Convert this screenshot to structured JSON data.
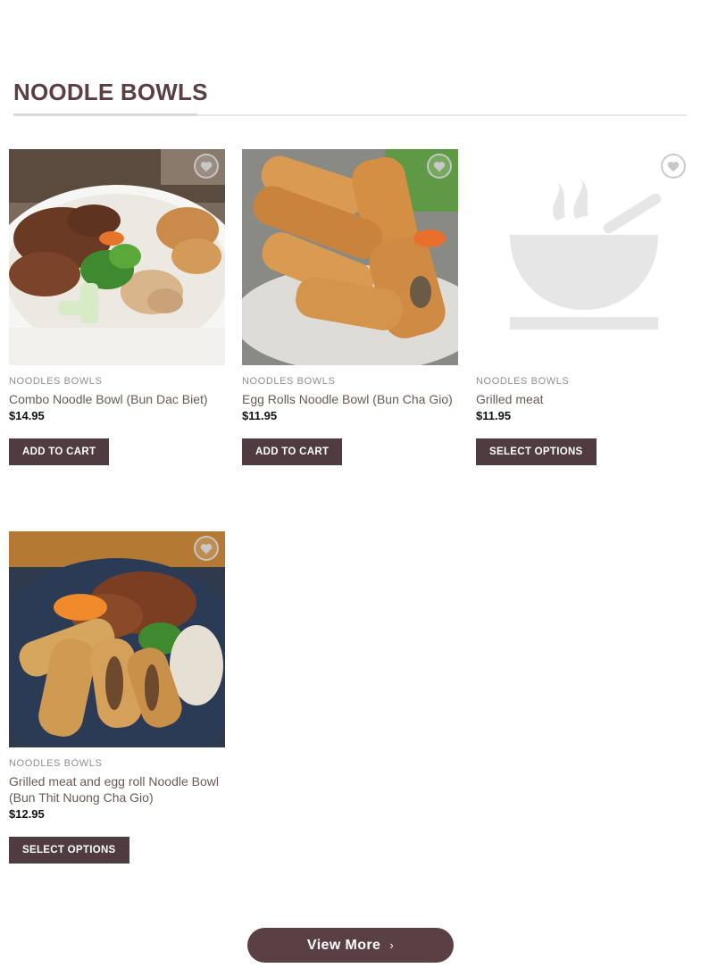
{
  "section": {
    "title": "NOODLE BOWLS"
  },
  "products": [
    {
      "category": "NOODLES BOWLS",
      "name": "Combo Noodle Bowl (Bun Dac Biet)",
      "price": "$14.95",
      "button": "ADD TO CART"
    },
    {
      "category": "NOODLES BOWLS",
      "name": "Egg Rolls Noodle Bowl (Bun Cha Gio)",
      "price": "$11.95",
      "button": "ADD TO CART"
    },
    {
      "category": "NOODLES BOWLS",
      "name": "Grilled meat",
      "price": "$11.95",
      "button": "SELECT OPTIONS"
    },
    {
      "category": "NOODLES BOWLS",
      "name": "Grilled meat and egg roll Noodle Bowl (Bun Thit Nuong Cha Gio)",
      "price": "$12.95",
      "button": "SELECT OPTIONS"
    }
  ],
  "view_more": {
    "label": "View More"
  },
  "icons": {
    "wishlist": "heart-icon",
    "placeholder": "soup-bowl-icon",
    "chevron": "chevron-right-icon"
  },
  "colors": {
    "brand": "#5a3f43",
    "button": "#4f3b40",
    "link": "#6b5a52"
  }
}
